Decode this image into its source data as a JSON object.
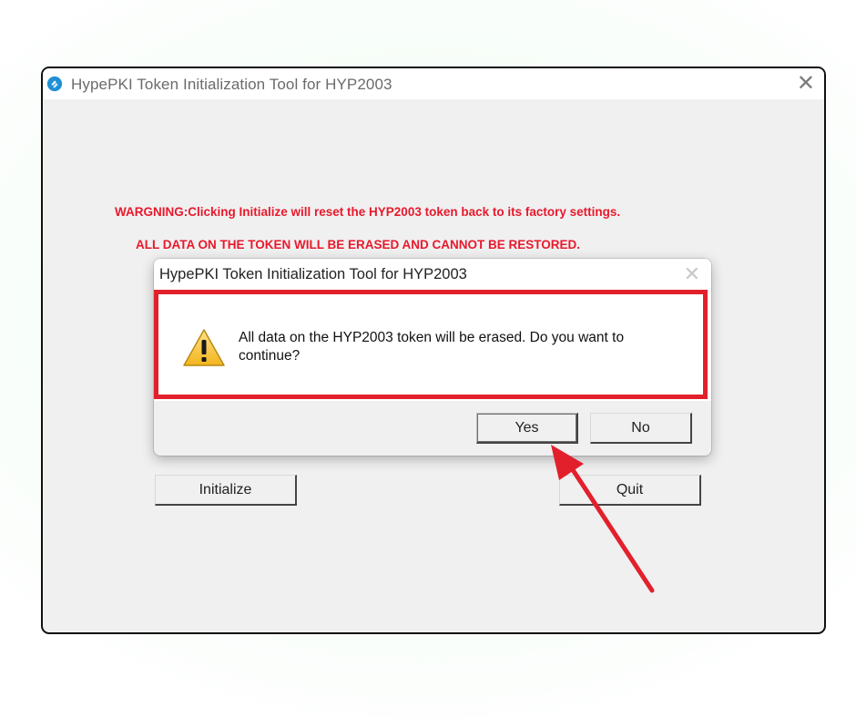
{
  "window": {
    "title": "HypePKI Token Initialization Tool for HYP2003",
    "close_glyph": "✕"
  },
  "main": {
    "warning_line_1": "WARGNING:Clicking Initialize will reset the HYP2003 token back to its factory settings.",
    "warning_line_2": "ALL DATA ON THE TOKEN WILL BE ERASED AND CANNOT BE RESTORED.",
    "initialize_label": "Initialize",
    "quit_label": "Quit"
  },
  "dialog": {
    "title": "HypePKI Token Initialization Tool for HYP2003",
    "close_glyph": "✕",
    "icon": "warning-icon",
    "message": "All data on the HYP2003 token will be erased. Do you want to continue?",
    "yes_label": "Yes",
    "no_label": "No"
  },
  "annotation": {
    "highlight_color": "#e2202c",
    "arrow_color": "#e2202c",
    "warning_text_color": "#e8192c"
  }
}
